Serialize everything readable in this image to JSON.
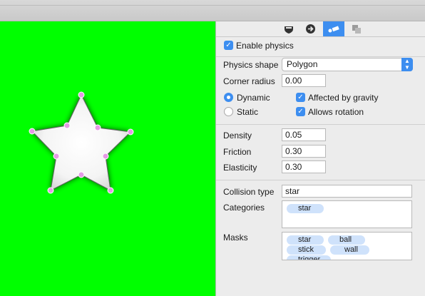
{
  "toolbar": {
    "tabs": [
      {
        "icon": "shield-icon"
      },
      {
        "icon": "arrow-right-icon"
      },
      {
        "icon": "physics-icon",
        "active": true
      },
      {
        "icon": "layers-icon"
      }
    ]
  },
  "physics": {
    "enable_label": "Enable physics",
    "shape_label": "Physics shape",
    "shape_value": "Polygon",
    "corner_label": "Corner radius",
    "corner_value": "0.00",
    "dynamic_label": "Dynamic",
    "static_label": "Static",
    "gravity_label": "Affected by gravity",
    "rotation_label": "Allows rotation",
    "density_label": "Density",
    "density_value": "0.05",
    "friction_label": "Friction",
    "friction_value": "0.30",
    "elasticity_label": "Elasticity",
    "elasticity_value": "0.30",
    "collision_label": "Collision type",
    "collision_value": "star",
    "categories_label": "Categories",
    "categories": [
      "star"
    ],
    "masks_label": "Masks",
    "masks": [
      "star",
      "ball",
      "stick",
      "wall",
      "trigger"
    ]
  },
  "colors": {
    "accent": "#3d8ef0",
    "canvas": "#00ff00",
    "tag": "#cfe2fb",
    "handle": "#e69ae6"
  }
}
